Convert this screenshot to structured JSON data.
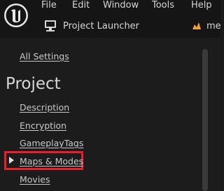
{
  "menu": {
    "items": [
      "File",
      "Edit",
      "Window",
      "Tools",
      "Help"
    ]
  },
  "toolbar": {
    "launcher_label": "Project Launcher",
    "project_tab_label": "me"
  },
  "sidebar": {
    "all_settings": "All Settings",
    "section_title": "Project",
    "items": [
      "Description",
      "Encryption",
      "GameplayTags",
      "Maps & Modes",
      "Movies"
    ],
    "selected_item": "Maps & Modes"
  },
  "colors": {
    "highlight": "#e8202a",
    "accent_tab_icon": "#f2a23c"
  }
}
